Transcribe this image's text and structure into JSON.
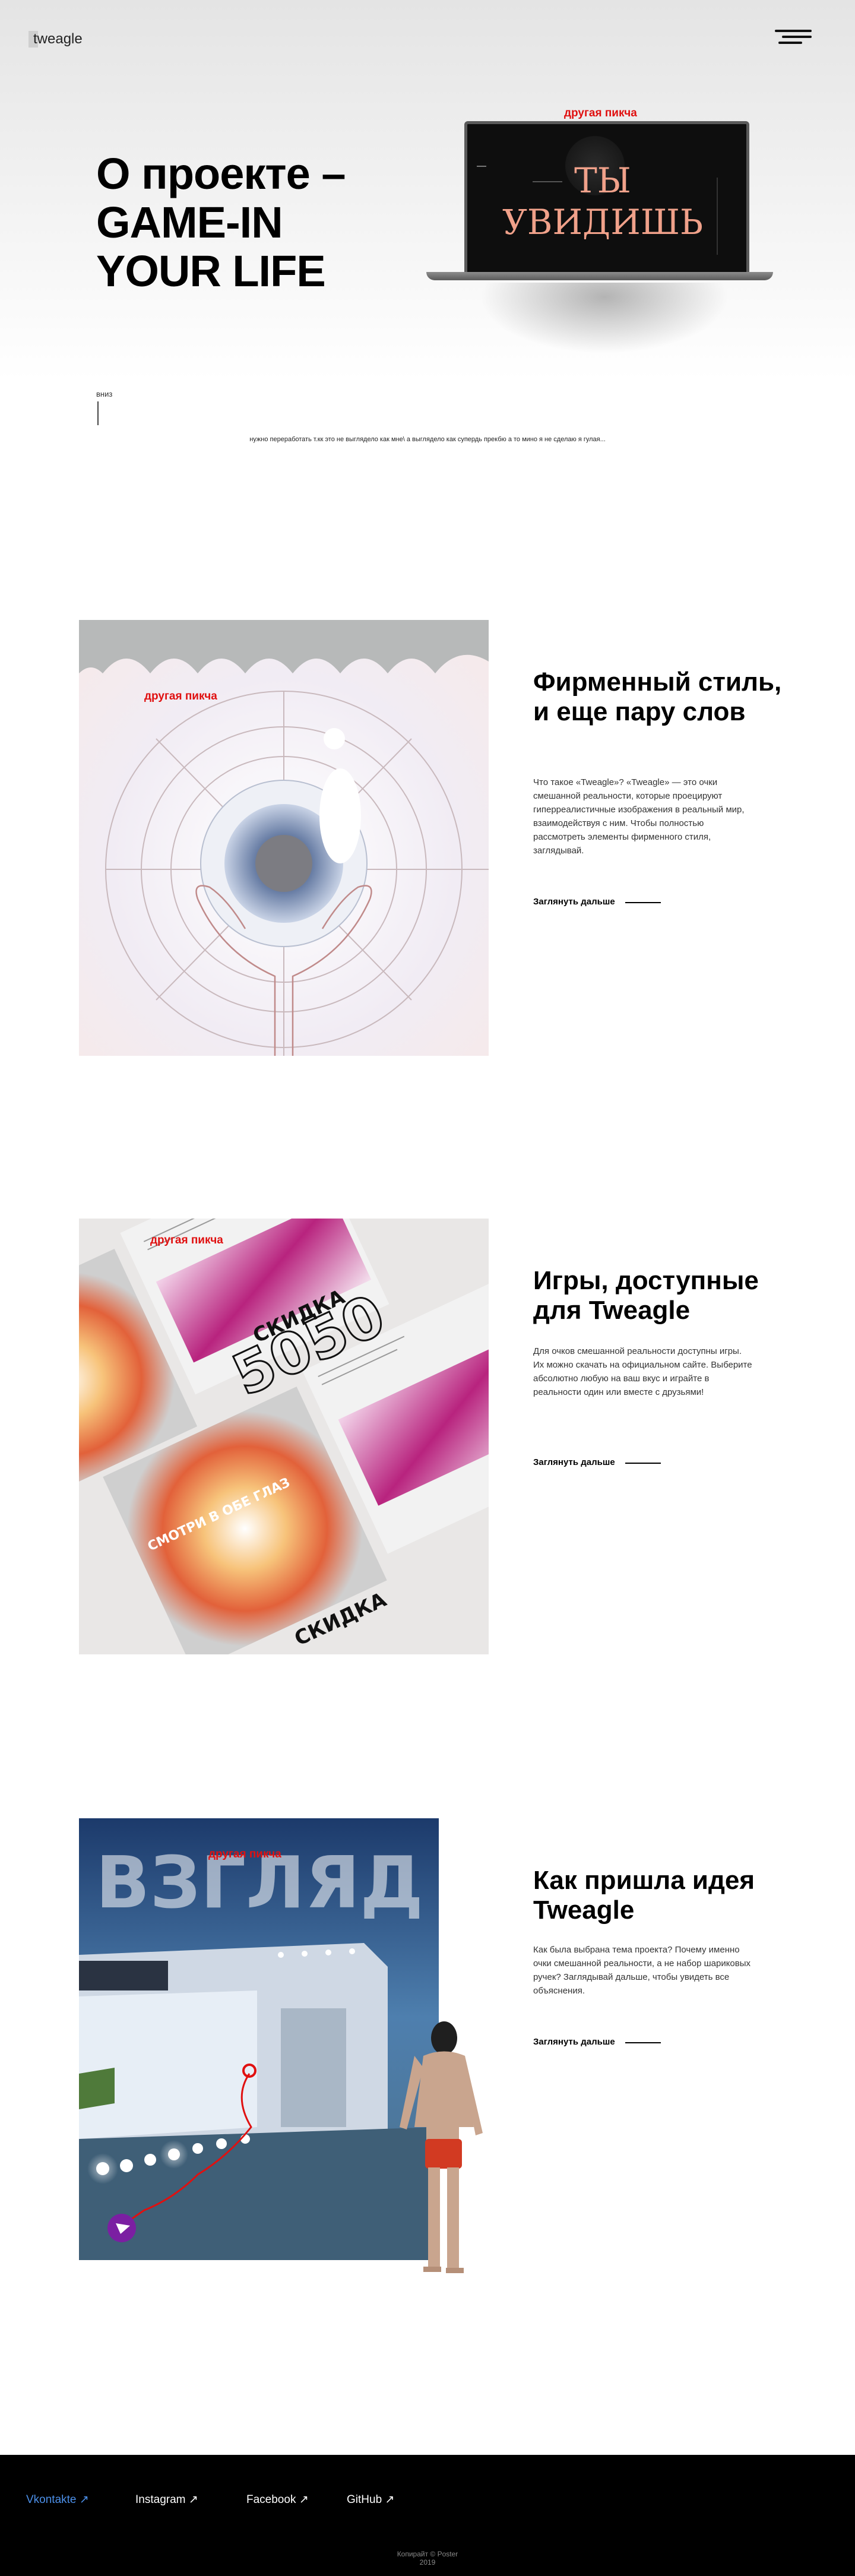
{
  "header": {
    "logo": "tweagle"
  },
  "hero": {
    "title_line1": "О проекте –",
    "title_line2": "GAME-IN",
    "title_line3": "YOUR LIFE",
    "image_label": "другая пикча",
    "screen_big_line1": "ТЫ",
    "screen_big_line2": "УВИДИШЬ",
    "down_label": "вниз",
    "note": "нужно переработать т.кк это не выглядело как мне\\ а выглядело как супердь прекбю а то мино я не сделаю я гулая..."
  },
  "sections": [
    {
      "image_label": "другая пикча",
      "title": "Фирменный стиль, и еще пару слов",
      "text": "Что такое «Tweagle»? «Tweagle» — это очки смешанной реальности, которые проецируют гиперреалистичные изображения в реальный мир, взаимодействуя с ним. Чтобы полностью рассмотреть элементы фирменного стиля, заглядывай.",
      "link": "Заглянуть дальше"
    },
    {
      "image_label": "другая пикча",
      "title": "Игры, доступные для Tweagle",
      "text": "Для очков смешанной реальности доступны игры. Их можно скачать на официальном сайте. Выберите абсолютно любую на ваш вкус и играйте в реальности один или вместе с друзьями!",
      "link": "Заглянуть дальше",
      "poster_words": [
        "СКИДКА",
        "5050",
        "СМОТРИ В ОБЕ ГЛАЗ"
      ]
    },
    {
      "image_label": "другая пикча",
      "title": "Как пришла идея Tweagle",
      "text": "Как была выбрана тема проекта? Почему именно очки смешанной реальности, а не набор шариковых ручек? Заглядывай дальше, чтобы увидеть все объяснения.",
      "link": "Заглянуть дальше",
      "poster_word": "ВЗГЛЯД"
    }
  ],
  "footer": {
    "links": [
      {
        "label": "Vkontakte ↗",
        "active": true
      },
      {
        "label": "Instagram ↗",
        "active": false
      },
      {
        "label": "Facebook ↗",
        "active": false
      },
      {
        "label": "GitHub ↗",
        "active": false
      }
    ],
    "copyright_line1": "Копирайт © Poster",
    "copyright_line2": "2019"
  },
  "colors": {
    "accent_label": "#e01010",
    "footer_active": "#4c8fe8"
  }
}
